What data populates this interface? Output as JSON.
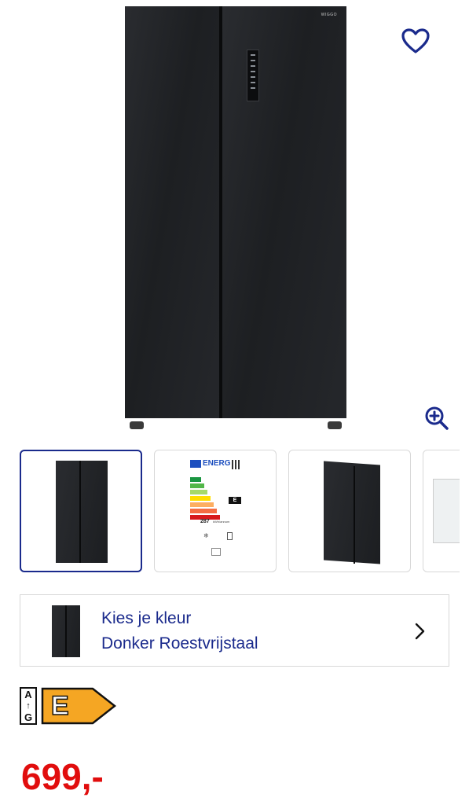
{
  "product": {
    "brand_mark": "WIGGO",
    "image_alt": "Side-by-side koelkast donker roestvrijstaal"
  },
  "icons": {
    "favorite": "heart-outline-icon",
    "zoom": "zoom-in-icon",
    "chevron": "chevron-right-icon"
  },
  "thumbnails": [
    {
      "kind": "front",
      "selected": true
    },
    {
      "kind": "energy-label",
      "selected": false
    },
    {
      "kind": "angle",
      "selected": false
    },
    {
      "kind": "interior",
      "selected": false
    }
  ],
  "energy_label_thumb": {
    "header": "ENERG",
    "class": "E",
    "consumption": "287",
    "unit": "kWh/annum"
  },
  "color_picker": {
    "title": "Kies je kleur",
    "value": "Donker Roestvrijstaal"
  },
  "energy_badge": {
    "scale_top": "A",
    "scale_bottom": "G",
    "class": "E"
  },
  "price": {
    "amount": "699,-"
  },
  "colors": {
    "accent": "#1a2a8c",
    "price": "#e10d0d",
    "badge": "#f5a623"
  }
}
